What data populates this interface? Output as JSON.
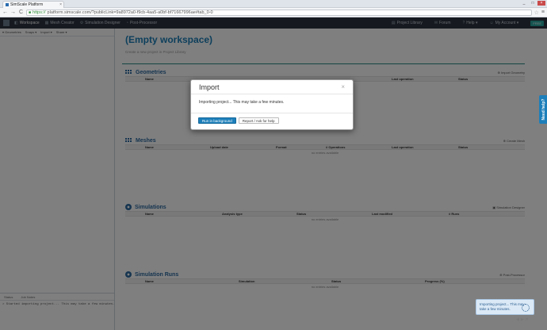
{
  "browser": {
    "tab_title": "SimScale Platform",
    "tab_close": "×",
    "url_scheme": "https://",
    "url_rest": "platform.simscale.com/?publicLink=9a8972a0-f9cb-4aa5-a0bf-bf71667996ae#tab_0-0",
    "back": "←",
    "forward": "→",
    "reload": "C",
    "star": "☆",
    "menu": "≡",
    "minimize": "_",
    "maximize": "□",
    "close": "×"
  },
  "topnav": {
    "items": [
      {
        "label": "Workspace",
        "icon": "◧"
      },
      {
        "label": "Mesh Creator",
        "icon": "▦"
      },
      {
        "label": "Simulation Designer",
        "icon": "⚙"
      },
      {
        "label": "Post-Processor",
        "icon": "◔"
      }
    ],
    "right": [
      {
        "label": "Project Library",
        "icon": "▤"
      },
      {
        "label": "Forum",
        "icon": "✉"
      },
      {
        "label": "Help ▾",
        "icon": "?"
      },
      {
        "label": "My Account ▾",
        "icon": "☺"
      }
    ],
    "plan_badge": "FREE"
  },
  "sidebar": {
    "tools": [
      "▾ Geometries",
      "Snaps ▾",
      "Import ▾",
      "Share ▾"
    ],
    "bottom_tabs": [
      "Status",
      "Job Notes"
    ],
    "log_line": "> Started importing project... This may take a few minutes."
  },
  "workspace": {
    "title": "(Empty workspace)",
    "subtitle": "Create a new project in Project Library"
  },
  "sections": [
    {
      "title": "Geometries",
      "action": "⊕ Import Geometry",
      "columns": [
        "Name",
        "Last operation",
        "Status"
      ],
      "empty": ""
    },
    {
      "title": "Meshes",
      "action": "⊕ Create Mesh",
      "columns": [
        "Name",
        "Upload date",
        "Format",
        "# Operations",
        "Last operation",
        "Status"
      ],
      "empty": "no entries available"
    },
    {
      "title": "Simulations",
      "action": "▣ Simulation Designer",
      "columns": [
        "Name",
        "Analysis type",
        "Status",
        "Last modified",
        "# Runs"
      ],
      "empty": "no entries available"
    },
    {
      "title": "Simulation Runs",
      "action": "⊕ Post-Processor",
      "columns": [
        "Name",
        "Simulation",
        "Status",
        "Progress (%)"
      ],
      "empty": "no entries available"
    }
  ],
  "need_help": "Need help?",
  "toast": {
    "text": "Importing project... This may take a few minutes."
  },
  "bottom_icons": [
    "◀",
    "▶",
    "✕"
  ],
  "modal": {
    "title": "Import",
    "close": "×",
    "message": "Importing project... This may take a few minutes.",
    "primary_button": "Run in background",
    "secondary_button": "Report / Ask for help"
  }
}
